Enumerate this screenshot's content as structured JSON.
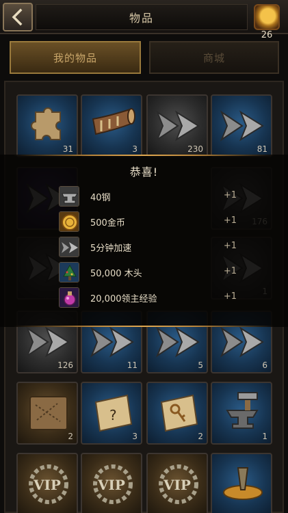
{
  "header": {
    "title": "物品",
    "back_icon": "chevron-left-icon",
    "currency_icon": "gold-coin-icon",
    "currency_count": "26"
  },
  "tabs": [
    {
      "label": "我的物品",
      "active": true
    },
    {
      "label": "商城",
      "active": false
    }
  ],
  "inventory": {
    "row1": [
      {
        "icon": "puzzle-piece-icon",
        "qty": "31"
      },
      {
        "icon": "war-horn-icon",
        "qty": "3"
      },
      {
        "icon": "speedup-arrow-icon",
        "qty": "230"
      },
      {
        "icon": "speedup-arrow-icon",
        "qty": "81"
      }
    ],
    "row2_partial": [
      {
        "icon": "speedup-arrow-icon",
        "qty": ""
      },
      {
        "icon": "speedup-arrow-icon",
        "qty": "176"
      }
    ],
    "row3_partial": [
      {
        "icon": "speedup-arrow-icon",
        "qty": ""
      },
      {
        "icon": "speedup-arrow-icon",
        "qty": "1"
      }
    ],
    "row4": [
      {
        "icon": "speedup-arrow-icon",
        "qty": "126"
      },
      {
        "icon": "speedup-arrow-icon",
        "qty": "11"
      },
      {
        "icon": "speedup-arrow-icon",
        "qty": "5"
      },
      {
        "icon": "speedup-arrow-icon",
        "qty": "6"
      }
    ],
    "row5": [
      {
        "icon": "map-scroll-icon",
        "qty": "2"
      },
      {
        "icon": "mystery-scroll-icon",
        "qty": "3"
      },
      {
        "icon": "key-scroll-icon",
        "qty": "2"
      },
      {
        "icon": "anvil-hammer-icon",
        "qty": "1"
      }
    ],
    "row6": [
      {
        "icon": "vip-badge-icon",
        "qty": ""
      },
      {
        "icon": "vip-badge-icon",
        "qty": ""
      },
      {
        "icon": "vip-badge-icon",
        "qty": ""
      },
      {
        "icon": "teleport-icon",
        "qty": ""
      }
    ]
  },
  "popup": {
    "title": "恭喜!",
    "rewards": [
      {
        "icon": "steel-anvil-icon",
        "name": "40钢",
        "amount": "+1"
      },
      {
        "icon": "gold-coin-icon",
        "name": "500金币",
        "amount": "+1"
      },
      {
        "icon": "speedup-arrow-icon",
        "name": "5分钟加速",
        "amount": "+1"
      },
      {
        "icon": "wood-tree-icon",
        "name": "50,000 木头",
        "amount": "+1"
      },
      {
        "icon": "lord-xp-potion-icon",
        "name": "20,000领主经验",
        "amount": "+1"
      }
    ]
  }
}
